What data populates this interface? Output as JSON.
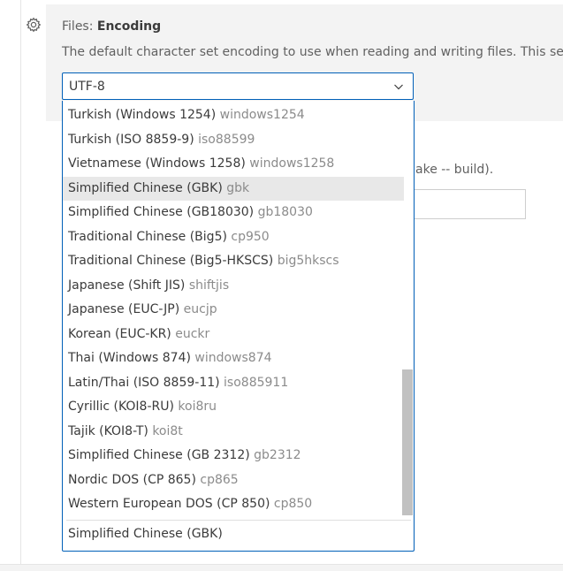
{
  "setting": {
    "category": "Files: ",
    "name": "Encoding",
    "description": "The default character set encoding to use when reading and writing files. This se",
    "selected_value": "UTF-8",
    "gear_icon": "gear-icon",
    "chevron_icon": "chevron-down-icon"
  },
  "background_setting": {
    "text_fragment": "ake -- build)."
  },
  "dropdown": {
    "options": [
      {
        "label": "Turkish (Windows 1254) ",
        "code": "windows1254"
      },
      {
        "label": "Turkish (ISO 8859-9) ",
        "code": "iso88599"
      },
      {
        "label": "Vietnamese (Windows 1258) ",
        "code": "windows1258"
      },
      {
        "label": "Simplified Chinese (GBK) ",
        "code": "gbk"
      },
      {
        "label": "Simplified Chinese (GB18030) ",
        "code": "gb18030"
      },
      {
        "label": "Traditional Chinese (Big5) ",
        "code": "cp950"
      },
      {
        "label": "Traditional Chinese (Big5-HKSCS) ",
        "code": "big5hkscs"
      },
      {
        "label": "Japanese (Shift JIS) ",
        "code": "shiftjis"
      },
      {
        "label": "Japanese (EUC-JP) ",
        "code": "eucjp"
      },
      {
        "label": "Korean (EUC-KR) ",
        "code": "euckr"
      },
      {
        "label": "Thai (Windows 874) ",
        "code": "windows874"
      },
      {
        "label": "Latin/Thai (ISO 8859-11) ",
        "code": "iso885911"
      },
      {
        "label": "Cyrillic (KOI8-RU) ",
        "code": "koi8ru"
      },
      {
        "label": "Tajik (KOI8-T) ",
        "code": "koi8t"
      },
      {
        "label": "Simplified Chinese (GB 2312) ",
        "code": "gb2312"
      },
      {
        "label": "Nordic DOS (CP 865) ",
        "code": "cp865"
      },
      {
        "label": "Western European DOS (CP 850) ",
        "code": "cp850"
      }
    ],
    "highlighted_index": 3,
    "footer_label": "Simplified Chinese (GBK)"
  },
  "colors": {
    "focus_border": "#005fb8",
    "highlight_bg": "#e8e8e8",
    "setting_bg": "#f3f3f3"
  }
}
